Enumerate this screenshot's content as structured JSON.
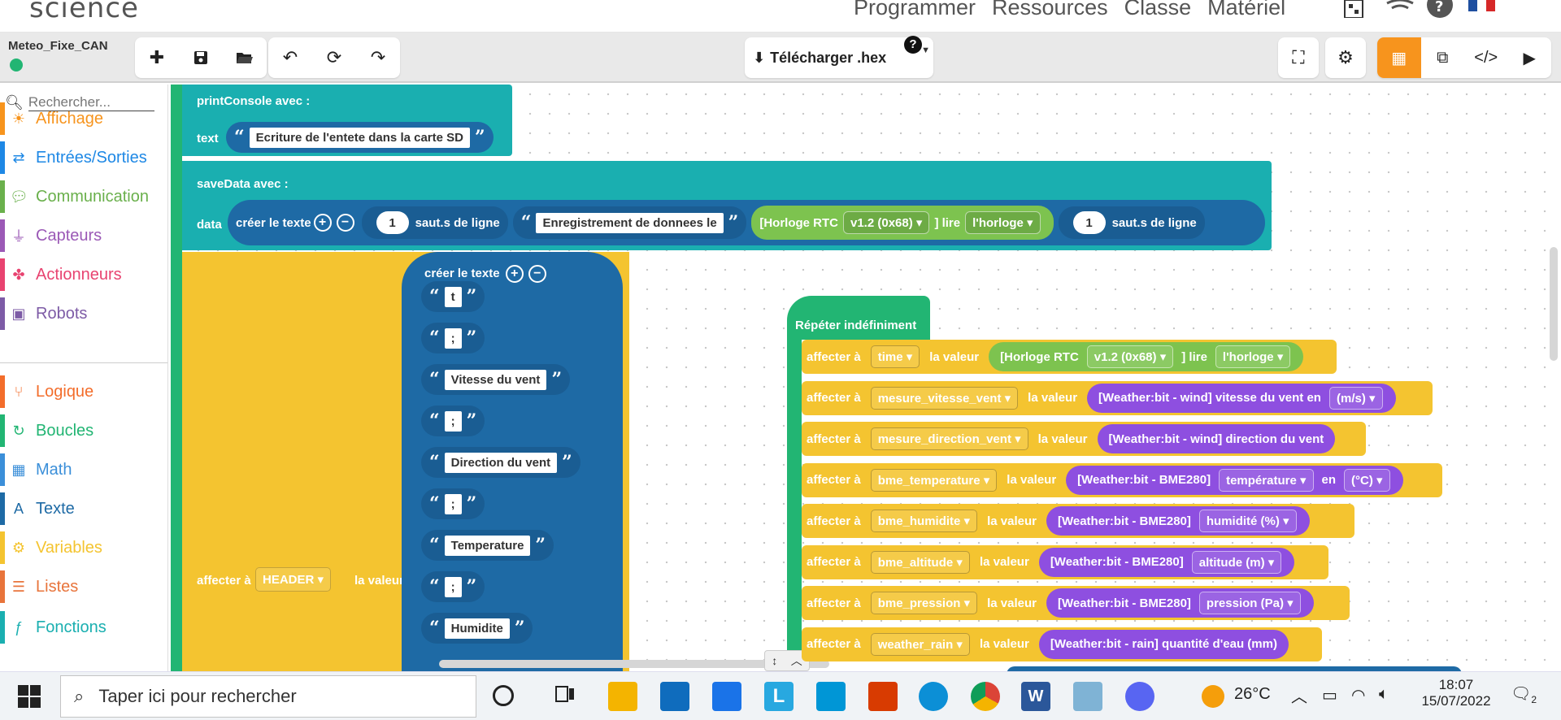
{
  "brand": {
    "logo_text": "science"
  },
  "nav": {
    "links": [
      "Programmer",
      "Ressources",
      "Classe",
      "Matériel"
    ]
  },
  "project": {
    "name": "Meteo_Fixe_CAN",
    "status_color": "#22b573"
  },
  "toolbar": {
    "file_icons": [
      "plus-icon",
      "save-icon",
      "folder-open-icon"
    ],
    "history_icons": [
      "undo-icon",
      "refresh-icon",
      "redo-icon"
    ],
    "download_label": "Télécharger .hex",
    "help_label": "?",
    "view_icons": [
      "blocks-view-icon",
      "hybrid-view-icon",
      "code-view-icon"
    ],
    "run_icon": "play-icon"
  },
  "sidebar": {
    "search_placeholder": "Rechercher...",
    "categories": [
      {
        "label": "Affichage",
        "color": "#f7941d",
        "icon": "sun-icon"
      },
      {
        "label": "Entrées/Sorties",
        "color": "#1e88e5",
        "icon": "arrows-icon"
      },
      {
        "label": "Communication",
        "color": "#6ab04c",
        "icon": "chat-icon"
      },
      {
        "label": "Capteurs",
        "color": "#9b59b6",
        "icon": "plug-icon"
      },
      {
        "label": "Actionneurs",
        "color": "#e84370",
        "icon": "fan-icon"
      },
      {
        "label": "Robots",
        "color": "#7d5ba6",
        "icon": "robot-icon"
      },
      {
        "label": "Logique",
        "color": "#f36d2b",
        "icon": "branch-icon"
      },
      {
        "label": "Boucles",
        "color": "#22b573",
        "icon": "loop-icon"
      },
      {
        "label": "Math",
        "color": "#3b8fd9",
        "icon": "calculator-icon"
      },
      {
        "label": "Texte",
        "color": "#1e6aa5",
        "icon": "text-icon"
      },
      {
        "label": "Variables",
        "color": "#f4c430",
        "icon": "gear-icon"
      },
      {
        "label": "Listes",
        "color": "#e8743b",
        "icon": "list-icon"
      },
      {
        "label": "Fonctions",
        "color": "#1aafb0",
        "icon": "function-icon"
      }
    ]
  },
  "blocks": {
    "print_console": {
      "title": "printConsole  avec :",
      "arg_label": "text",
      "string": "Ecriture de l'entete dans la carte SD"
    },
    "save_data": {
      "title": "saveData  avec :",
      "arg_label": "data",
      "create_text": "créer le texte",
      "newline_count": "1",
      "newline_label": "saut.s de ligne",
      "string": "Enregistrement de donnees le",
      "rtc_label": "[Horloge RTC",
      "rtc_version": "v1.2 (0x68)",
      "rtc_read": "] lire",
      "rtc_target": "l'horloge"
    },
    "header_assign": {
      "label": "affecter à",
      "variable": "HEADER",
      "value_label": "la valeur",
      "create_text": "créer le texte",
      "items": [
        "t",
        ";",
        "Vitesse du vent",
        ";",
        "Direction du vent",
        ";",
        "Temperature",
        ";",
        "Humidite"
      ]
    },
    "repeat": {
      "title": "Répéter indéfiniment",
      "assign_label": "affecter à",
      "value_label": "la valeur",
      "rows": [
        {
          "var": "time",
          "parts": [
            "[Horloge RTC",
            "v1.2 (0x68)",
            "] lire",
            "l'horloge"
          ]
        },
        {
          "var": "mesure_vitesse_vent",
          "parts": [
            "[Weather:bit - wind] vitesse du vent en",
            "(m/s)"
          ]
        },
        {
          "var": "mesure_direction_vent",
          "parts": [
            "[Weather:bit - wind] direction du vent"
          ]
        },
        {
          "var": "bme_temperature",
          "parts": [
            "[Weather:bit - BME280]",
            "température",
            "en",
            "(°C)"
          ]
        },
        {
          "var": "bme_humidite",
          "parts": [
            "[Weather:bit - BME280]",
            "humidité (%)"
          ]
        },
        {
          "var": "bme_altitude",
          "parts": [
            "[Weather:bit - BME280]",
            "altitude (m)"
          ]
        },
        {
          "var": "bme_pression",
          "parts": [
            "[Weather:bit - BME280]",
            "pression (Pa)"
          ]
        },
        {
          "var": "weather_rain",
          "parts": [
            "[Weather:bit - rain] quantité d'eau (mm)"
          ]
        }
      ]
    }
  },
  "taskbar": {
    "search_placeholder": "Taper ici pour rechercher",
    "weather": "26°C",
    "time": "18:07",
    "date": "15/07/2022",
    "notifications": "2"
  },
  "colors": {
    "teal": "#1aafb0",
    "yellow": "#f4c430",
    "blue": "#1e6aa5",
    "green": "#22b573",
    "lime": "#7dc34f",
    "purple": "#8e4fe0",
    "orange": "#f7941d"
  }
}
